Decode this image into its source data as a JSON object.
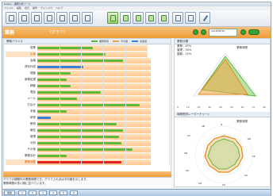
{
  "window": {
    "title": "Kaizen - 業務分析ツール"
  },
  "menu": [
    "ファイル",
    "編集",
    "表示",
    "操作",
    "ウィンドウ",
    "ヘルプ"
  ],
  "header": {
    "title": "業務",
    "subtitle": "(グラフ)",
    "date": "2016/06/30"
  },
  "left_panel": {
    "title": "業務バランス",
    "legend": [
      "業務時間",
      "平均値",
      "最長値"
    ],
    "rows": [
      {
        "label": "営業",
        "bar_color": "#5fb83a",
        "value": 0.42,
        "band": 0.83,
        "highlight": false
      },
      {
        "label": "企画",
        "bar_color": "#5fb83a",
        "value": 0.52,
        "band": 0.84,
        "highlight": true
      },
      {
        "label": "会議",
        "bar_color": "#5fb83a",
        "value": 0.65,
        "band": 0.86,
        "highlight": false
      },
      {
        "label": "資料作成",
        "bar_color": "#3b7fd6",
        "value": 0.35,
        "band": 0.86,
        "highlight": false
      },
      {
        "label": "調査",
        "bar_color": "#5fb83a",
        "value": 0.25,
        "band": 0.86,
        "highlight": false
      },
      {
        "label": "事務処理",
        "bar_color": "#5fb83a",
        "value": 0.22,
        "band": 0.86,
        "highlight": false
      },
      {
        "label": "移動",
        "bar_color": "#5fb83a",
        "value": 0.25,
        "band": 0.86,
        "highlight": false
      },
      {
        "label": "電話",
        "bar_color": "#5fb83a",
        "value": 0.48,
        "band": 0.86,
        "highlight": false
      },
      {
        "label": "メール",
        "bar_color": "#5fb83a",
        "value": 0.3,
        "band": 0.86,
        "highlight": false
      },
      {
        "label": "打合せ",
        "bar_color": "#5fb83a",
        "value": 0.78,
        "band": 0.86,
        "highlight": false
      },
      {
        "label": "来客",
        "bar_color": "#5fb83a",
        "value": 0.22,
        "band": 0.86,
        "highlight": false
      },
      {
        "label": "研修",
        "bar_color": "#3b7fd6",
        "value": 0.1,
        "band": 0.86,
        "highlight": false
      },
      {
        "label": "教育",
        "bar_color": "#5fb83a",
        "value": 0.6,
        "band": 0.86,
        "highlight": false
      },
      {
        "label": "報告",
        "bar_color": "#5fb83a",
        "value": 0.65,
        "band": 0.86,
        "highlight": false
      },
      {
        "label": "管理",
        "bar_color": "#5fb83a",
        "value": 0.62,
        "band": 0.86,
        "highlight": false
      },
      {
        "label": "分析",
        "bar_color": "#5fb83a",
        "value": 0.64,
        "band": 0.86,
        "highlight": false
      },
      {
        "label": "その他",
        "bar_color": "#5fb83a",
        "value": 0.72,
        "band": 0.86,
        "highlight": false
      },
      {
        "label": "業務合計",
        "bar_color": "#5fb83a",
        "value": 0.22,
        "band": 0.86,
        "highlight": false
      },
      {
        "label": "業務改善",
        "bar_color": "#e32020",
        "value": 0.64,
        "band": 0.86,
        "highlight": true
      }
    ]
  },
  "note": {
    "line1": "グラフの期間内の業務時間です。グラフ上の点は平均値を示します。",
    "line2": "業務時間の多い順に並べています。"
  },
  "right_panel": {
    "radar1_title": "業務分類",
    "radar1_legend": [
      "業務 : 45%",
      "管理 : 30%",
      "雑務 : 25%"
    ],
    "radar1_scale_label": "業務時間",
    "scale_ticks": [
      "0",
      "10",
      "20",
      "30",
      "40",
      "50",
      "60",
      "70",
      "80"
    ],
    "radar2_title": "時間帯別レーダーチャート",
    "radar2_label": "業務時間",
    "radar2_axes": [
      "9",
      "10",
      "11",
      "12",
      "13",
      "14",
      "15",
      "16",
      "17",
      "18"
    ]
  },
  "taskbar": [
    "開始",
    "1",
    "2",
    "3",
    "4",
    "5",
    "6"
  ],
  "colors": {
    "accent_orange": "#ee9b35",
    "green": "#5fb83a",
    "blue": "#3b7fd6",
    "red": "#e32020"
  }
}
